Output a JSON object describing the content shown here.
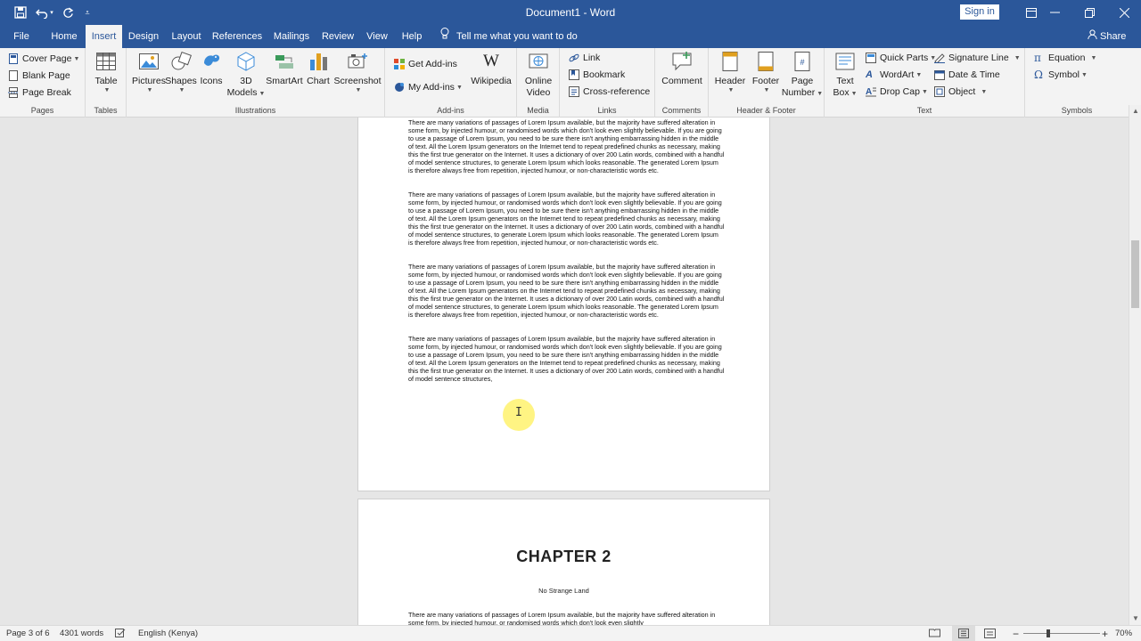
{
  "window": {
    "title": "Document1  -  Word",
    "sign_in": "Sign in"
  },
  "tabs": [
    "File",
    "Home",
    "Insert",
    "Design",
    "Layout",
    "References",
    "Mailings",
    "Review",
    "View",
    "Help"
  ],
  "active_tab": "Insert",
  "tell_me": "Tell me what you want to do",
  "share": "Share",
  "ribbon": {
    "pages": {
      "label": "Pages",
      "cover_page": "Cover Page",
      "blank_page": "Blank Page",
      "page_break": "Page Break"
    },
    "tables": {
      "label": "Tables",
      "table": "Table"
    },
    "illustrations": {
      "label": "Illustrations",
      "pictures": "Pictures",
      "shapes": "Shapes",
      "icons": "Icons",
      "models_3d_line1": "3D",
      "models_3d_line2": "Models",
      "smartart": "SmartArt",
      "chart": "Chart",
      "screenshot": "Screenshot"
    },
    "addins": {
      "label": "Add-ins",
      "get_addins": "Get Add-ins",
      "my_addins": "My Add-ins",
      "wikipedia": "Wikipedia"
    },
    "media": {
      "label": "Media",
      "online_line1": "Online",
      "online_line2": "Video"
    },
    "links": {
      "label": "Links",
      "link": "Link",
      "bookmark": "Bookmark",
      "cross_reference": "Cross-reference"
    },
    "comments": {
      "label": "Comments",
      "comment": "Comment"
    },
    "header_footer": {
      "label": "Header & Footer",
      "header": "Header",
      "footer": "Footer",
      "page_line1": "Page",
      "page_line2": "Number"
    },
    "text": {
      "label": "Text",
      "textbox_line1": "Text",
      "textbox_line2": "Box",
      "quick_parts": "Quick Parts",
      "wordart": "WordArt",
      "drop_cap": "Drop Cap",
      "signature_line": "Signature Line",
      "date_time": "Date & Time",
      "object": "Object"
    },
    "symbols": {
      "label": "Symbols",
      "equation": "Equation",
      "symbol": "Symbol"
    }
  },
  "document": {
    "paragraphs": [
      "There are many variations of passages of Lorem Ipsum available, but the majority have suffered alteration in some form, by injected humour, or randomised words which don't look even slightly believable. If you are going to use a passage of Lorem Ipsum, you need to be sure there isn't anything embarrassing hidden in the middle of text. All the Lorem Ipsum generators on the Internet tend to repeat predefined chunks as necessary, making this the first true generator on the Internet. It uses a dictionary of over 200 Latin words, combined with a handful of model sentence structures, to generate Lorem Ipsum which looks reasonable. The generated Lorem Ipsum is therefore always free from repetition, injected humour, or non-characteristic words etc.",
      "There are many variations of passages of Lorem Ipsum available, but the majority have suffered alteration in some form, by injected humour, or randomised words which don't look even slightly believable. If you are going to use a passage of Lorem Ipsum, you need to be sure there isn't anything embarrassing hidden in the middle of text. All the Lorem Ipsum generators on the Internet tend to repeat predefined chunks as necessary, making this the first true generator on the Internet. It uses a dictionary of over 200 Latin words, combined with a handful of model sentence structures, to generate Lorem Ipsum which looks reasonable. The generated Lorem Ipsum is therefore always free from repetition, injected humour, or non-characteristic words etc.",
      "There are many variations of passages of Lorem Ipsum available, but the majority have suffered alteration in some form, by injected humour, or randomised words which don't look even slightly believable. If you are going to use a passage of Lorem Ipsum, you need to be sure there isn't anything embarrassing hidden in the middle of text. All the Lorem Ipsum generators on the Internet tend to repeat predefined chunks as necessary, making this the first true generator on the Internet. It uses a dictionary of over 200 Latin words, combined with a handful of model sentence structures, to generate Lorem Ipsum which looks reasonable. The generated Lorem Ipsum is therefore always free from repetition, injected humour, or non-characteristic words etc.",
      "There are many variations of passages of Lorem Ipsum available, but the majority have suffered alteration in some form, by injected humour, or randomised words which don't look even slightly believable. If you are going to use a passage of Lorem Ipsum, you need to be sure there isn't anything embarrassing hidden in the middle of text. All the Lorem Ipsum generators on the Internet tend to repeat predefined chunks as necessary, making this the first true generator on the Internet. It uses a dictionary of over 200 Latin words, combined with a handful of model sentence structures,"
    ],
    "chapter_title": "CHAPTER 2",
    "chapter_subtitle": "No Strange Land",
    "page2_paragraph": "There are many variations of passages of Lorem Ipsum available, but the majority have suffered alteration in some form, by injected humour, or randomised words which don't look even slightly"
  },
  "status": {
    "page": "Page 3 of 6",
    "words": "4301 words",
    "language": "English (Kenya)",
    "zoom": "70%"
  },
  "colors": {
    "accent": "#2b579a",
    "ribbon_bg": "#f3f3f3",
    "canvas_bg": "#e6e6e6"
  }
}
